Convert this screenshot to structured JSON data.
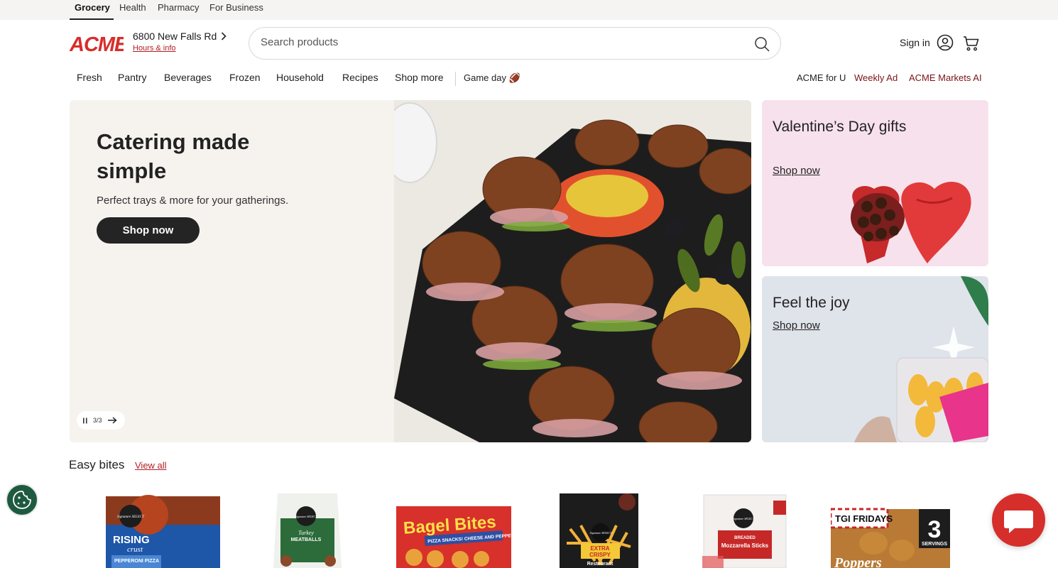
{
  "top_tabs": [
    {
      "label": "Grocery",
      "active": true
    },
    {
      "label": "Health",
      "active": false
    },
    {
      "label": "Pharmacy",
      "active": false
    },
    {
      "label": "For Business",
      "active": false
    }
  ],
  "header": {
    "logo_text": "ACME",
    "store_address": "6800 New Falls Rd",
    "hours_link": "Hours & info",
    "search_placeholder": "Search products",
    "sign_in": "Sign in"
  },
  "nav": {
    "items": [
      "Fresh",
      "Pantry",
      "Beverages",
      "Frozen",
      "Household",
      "Recipes",
      "Shop more"
    ],
    "game_day": "Game day 🏈",
    "right": [
      "ACME for U",
      "Weekly Ad",
      "ACME Markets AI"
    ]
  },
  "hero": {
    "title": "Catering made simple",
    "subtitle": "Perfect trays & more for your gatherings.",
    "cta": "Shop now",
    "carousel_counter": "3/3"
  },
  "promos": [
    {
      "title": "Valentine’s Day gifts",
      "link": "Shop now"
    },
    {
      "title": "Feel the joy",
      "link": "Shop now"
    }
  ],
  "section": {
    "title": "Easy bites",
    "view_all": "View all"
  },
  "products": [
    {
      "brand": "Signature SELECT",
      "line1": "RISING",
      "line2": "crust",
      "line3": "PEPPERONI PIZZA"
    },
    {
      "brand": "Signature SELECT",
      "line1": "Turkey",
      "line2": "MEATBALLS",
      "line3": ""
    },
    {
      "brand": "",
      "line1": "Bagel Bites",
      "line2": "PIZZA SNACKS! CHEESE AND PEPPERONI",
      "line3": ""
    },
    {
      "brand": "Signature SELECT",
      "line1": "EXTRA",
      "line2": "CRISPY",
      "line3": "Restaurant"
    },
    {
      "brand": "Signature SELECT",
      "line1": "BREADED",
      "line2": "Mozzarella Sticks",
      "line3": ""
    },
    {
      "brand": "TGI FRIDAYS",
      "line1": "Poppers",
      "line2": "3",
      "line3": "SERVINGS"
    }
  ],
  "colors": {
    "brand_red": "#d62e2b",
    "link_red": "#b01e23",
    "dark_button": "#242424",
    "promo_pink": "#f7e1ec",
    "promo_gray": "#dfe3ea",
    "hero_bg": "#f6f3ef"
  }
}
